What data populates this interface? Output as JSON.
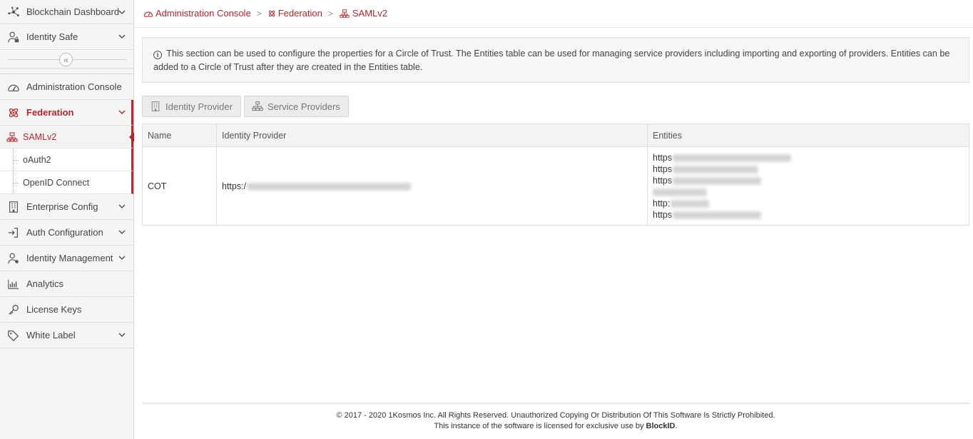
{
  "sidebar": {
    "items_top": [
      {
        "label": "Blockchain Dashboard",
        "icon": "blockchain-network-icon"
      },
      {
        "label": "Identity Safe",
        "icon": "user-lock-icon"
      }
    ],
    "items": [
      {
        "label": "Administration Console",
        "icon": "speedometer-icon"
      },
      {
        "label": "Federation",
        "icon": "atom-icon"
      },
      {
        "label": "Enterprise Config",
        "icon": "building-icon"
      },
      {
        "label": "Auth Configuration",
        "icon": "sign-in-icon"
      },
      {
        "label": "Identity Management",
        "icon": "user-gear-icon"
      },
      {
        "label": "Analytics",
        "icon": "bar-chart-icon"
      },
      {
        "label": "License Keys",
        "icon": "key-icon"
      },
      {
        "label": "White Label",
        "icon": "tag-icon"
      }
    ],
    "federation_sub": [
      {
        "label": "SAMLv2",
        "icon": "saml-icon"
      },
      {
        "label": "oAuth2"
      },
      {
        "label": "OpenID Connect"
      }
    ],
    "collapse_glyph": "«"
  },
  "breadcrumb": {
    "items": [
      "Administration Console",
      "Federation",
      "SAMLv2"
    ],
    "separator": ">"
  },
  "info": {
    "icon_glyph": "i",
    "text": "This section can be used to configure the properties for a Circle of Trust. The Entities table can be used for managing service providers including importing and exporting of providers. Entities can be added to a Circle of Trust after they are created in the Entities table."
  },
  "tabs": [
    {
      "label": "Identity Provider",
      "icon": "building-icon"
    },
    {
      "label": "Service Providers",
      "icon": "sitemap-icon"
    }
  ],
  "table": {
    "headers": [
      "Name",
      "Identity Provider",
      "Entities"
    ],
    "rows": [
      {
        "name": "COT",
        "idp_prefix": "https:/",
        "entities": [
          "https",
          "https",
          "https",
          "",
          "http:",
          "https"
        ]
      }
    ]
  },
  "footer": {
    "line1": "© 2017 - 2020  1Kosmos Inc. All Rights Reserved. Unauthorized Copying Or Distribution Of This Software Is Strictly Prohibited.",
    "line2_prefix": "This instance of the software is licensed for exclusive use by ",
    "line2_brand": "BlockID",
    "line2_suffix": "."
  },
  "colors": {
    "accent": "#b3262d",
    "sidebar_bg": "#f5f5f5"
  }
}
